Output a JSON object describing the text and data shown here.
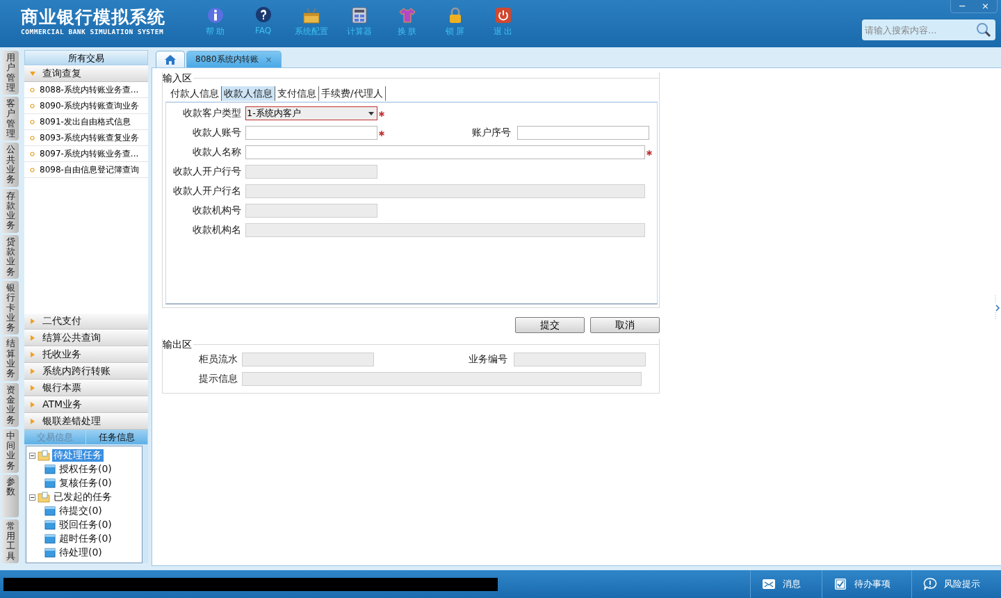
{
  "app": {
    "title": "商业银行模拟系统",
    "subtitle": "COMMERCIAL BANK SIMULATION SYSTEM"
  },
  "toolbar": [
    {
      "label": "帮 助",
      "kind": "info"
    },
    {
      "label": "FAQ",
      "kind": "question"
    },
    {
      "label": "系统配置",
      "kind": "toolbox"
    },
    {
      "label": "计算器",
      "kind": "calculator"
    },
    {
      "label": "换 肤",
      "kind": "shirt"
    },
    {
      "label": "锁 屏",
      "kind": "lock"
    },
    {
      "label": "退 出",
      "kind": "power"
    }
  ],
  "window_controls": [
    "−",
    "×"
  ],
  "search": {
    "placeholder": "请输入搜索内容..."
  },
  "vertical_tabs": [
    "用户管理",
    "客户管理",
    "公共业务",
    "存款业务",
    "贷款业务",
    "银行卡业务",
    "结算业务",
    "资金业务",
    "中间业务",
    "参数",
    "常用工具"
  ],
  "sidebar": {
    "header": "所有交易",
    "groups": [
      {
        "label": "查询查复",
        "expanded": true,
        "items": [
          "8088-系统内转账业务查...",
          "8090-系统内转账查询业务",
          "8091-发出自由格式信息",
          "8093-系统内转账查复业务",
          "8097-系统内转账业务查...",
          "8098-自由信息登记簿查询"
        ]
      },
      {
        "label": "二代支付",
        "expanded": false
      },
      {
        "label": "结算公共查询",
        "expanded": false
      },
      {
        "label": "托收业务",
        "expanded": false
      },
      {
        "label": "系统内跨行转账",
        "expanded": false
      },
      {
        "label": "银行本票",
        "expanded": false
      },
      {
        "label": "ATM业务",
        "expanded": false
      },
      {
        "label": "银联差错处理",
        "expanded": false
      }
    ]
  },
  "task_panel": {
    "tabs": [
      {
        "label": "交易信息",
        "selected": false
      },
      {
        "label": "任务信息",
        "selected": true
      }
    ],
    "tree": [
      {
        "label": "待处理任务",
        "selected": true,
        "expanded": true,
        "children": [
          {
            "label": "授权任务(0)",
            "selected": false
          },
          {
            "label": "复核任务(0)",
            "selected": false
          }
        ]
      },
      {
        "label": "已发起的任务",
        "selected": false,
        "expanded": true,
        "children": [
          {
            "label": "待提交(0)",
            "selected": false
          },
          {
            "label": "驳回任务(0)",
            "selected": false
          },
          {
            "label": "超时任务(0)",
            "selected": false
          },
          {
            "label": "待处理(0)",
            "selected": false
          }
        ]
      }
    ]
  },
  "page_tabs": [
    {
      "kind": "home",
      "selected": false
    },
    {
      "kind": "page",
      "label": "8080系统内转账",
      "selected": true,
      "close": "×"
    }
  ],
  "input_area": {
    "legend": "输入区",
    "tabs": [
      {
        "label": "付款人信息",
        "selected": false
      },
      {
        "label": "收款人信息",
        "selected": true
      },
      {
        "label": "支付信息",
        "selected": false
      },
      {
        "label": "手续费/代理人",
        "selected": false
      }
    ],
    "rows": [
      [
        {
          "label": "收款客户类型",
          "kind": "select",
          "value": "1-系统内客户",
          "required": true
        }
      ],
      [
        {
          "label": "收款人账号",
          "kind": "short",
          "required": true,
          "disabled": false
        },
        {
          "label": "账户序号",
          "kind": "short",
          "required": false,
          "disabled": false
        }
      ],
      [
        {
          "label": "收款人名称",
          "kind": "long",
          "required": true,
          "disabled": false
        }
      ],
      [
        {
          "label": "收款人开户行号",
          "kind": "short",
          "required": false,
          "disabled": true
        }
      ],
      [
        {
          "label": "收款人开户行名",
          "kind": "long",
          "required": false,
          "disabled": true
        }
      ],
      [
        {
          "label": "收款机构号",
          "kind": "short",
          "required": false,
          "disabled": true
        }
      ],
      [
        {
          "label": "收款机构名",
          "kind": "long",
          "required": false,
          "disabled": true
        }
      ]
    ]
  },
  "buttons": [
    "提交",
    "取消"
  ],
  "output_area": {
    "legend": "输出区",
    "rows": [
      [
        {
          "label": "柜员流水",
          "kind": "short",
          "required": false,
          "disabled": true
        },
        {
          "label": "业务编号",
          "kind": "short",
          "required": false,
          "disabled": true
        }
      ],
      [
        {
          "label": "提示信息",
          "kind": "long",
          "required": false,
          "disabled": true
        }
      ]
    ]
  },
  "status_bar": [
    {
      "label": "消息",
      "kind": "mail"
    },
    {
      "label": "待办事项",
      "kind": "checkbox"
    },
    {
      "label": "风险提示",
      "kind": "alert"
    }
  ]
}
